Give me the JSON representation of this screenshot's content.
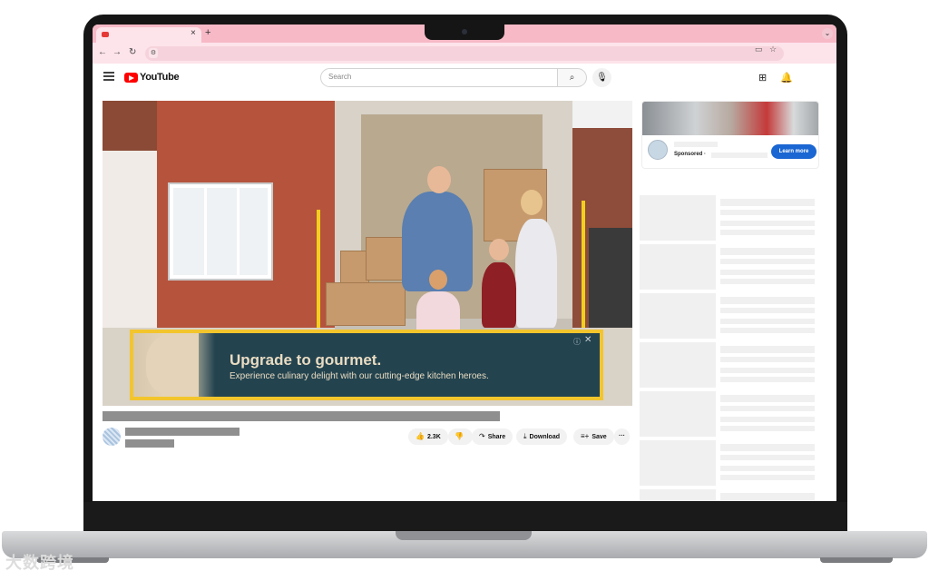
{
  "browser": {
    "tab_close": "×",
    "new_tab": "+",
    "nav_back": "←",
    "nav_forward": "→",
    "nav_reload": "↻",
    "tab_menu": "⌄"
  },
  "youtube": {
    "logo_text": "YouTube",
    "search_placeholder": "Search",
    "search_icon": "search-icon",
    "mic_icon": "mic-icon",
    "create_icon": "create-video-icon",
    "bell_icon": "bell-icon"
  },
  "overlay_ad": {
    "title": "Upgrade to gourmet.",
    "subtitle": "Experience culinary delight with our cutting-edge kitchen heroes.",
    "info_glyph": "ⓘ",
    "close_glyph": "✕"
  },
  "actions": {
    "like_count": "2.3K",
    "share": "Share",
    "download": "Download",
    "save": "Save",
    "more": "···"
  },
  "sidebar_ad": {
    "sponsored": "Sponsored ·",
    "cta": "Learn more"
  },
  "watermark": "大数跨境",
  "colors": {
    "tabbar": "#f7b9c6",
    "toolbar": "#fde3ea",
    "ad_bg": "#23434f",
    "ad_border": "#f3c52d",
    "ad_text": "#e9dcc2",
    "cta": "#1a66d2",
    "youtube_red": "#ff0000"
  }
}
